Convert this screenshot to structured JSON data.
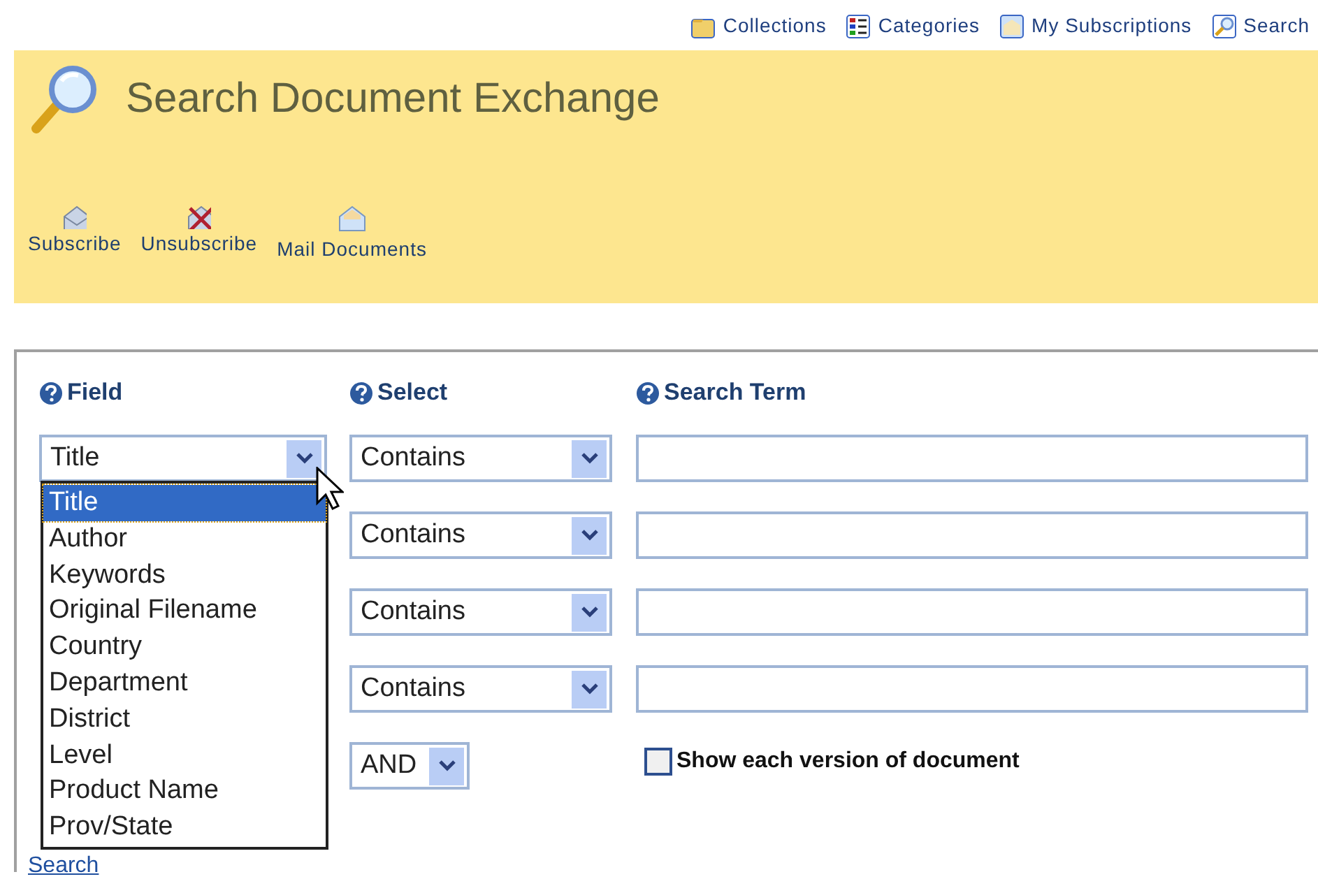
{
  "nav": [
    {
      "kind": "folder",
      "label": "Collections"
    },
    {
      "kind": "list",
      "label": "Categories"
    },
    {
      "kind": "mail",
      "label": "My Subscriptions"
    },
    {
      "kind": "search",
      "label": "Search"
    }
  ],
  "header": {
    "title": "Search Document Exchange"
  },
  "actions": [
    {
      "kind": "subscribe",
      "label": "Subscribe"
    },
    {
      "kind": "unsubscribe",
      "label": "Unsubscribe"
    },
    {
      "kind": "mail",
      "label": "Mail Documents"
    }
  ],
  "form": {
    "columns": [
      "Field",
      "Select",
      "Search Term"
    ],
    "rows": [
      {
        "field": "Title",
        "operator": "Contains"
      },
      {
        "operator": "Contains"
      },
      {
        "operator": "Contains"
      },
      {
        "operator": "Contains"
      }
    ],
    "field_options": [
      {
        "label": "Title",
        "selected": true
      },
      {
        "label": "Author",
        "selected": false
      },
      {
        "label": "Keywords",
        "selected": false
      },
      {
        "label": "Original Filename",
        "selected": false
      },
      {
        "label": "Country",
        "selected": false
      },
      {
        "label": "Department",
        "selected": false
      },
      {
        "label": "District",
        "selected": false
      },
      {
        "label": "Level",
        "selected": false
      },
      {
        "label": "Product Name",
        "selected": false
      },
      {
        "label": "Prov/State",
        "selected": false
      }
    ],
    "conjunction": "AND",
    "show_versions": {
      "label": "Show each version of document",
      "checked": false
    }
  },
  "search_link": "Search"
}
